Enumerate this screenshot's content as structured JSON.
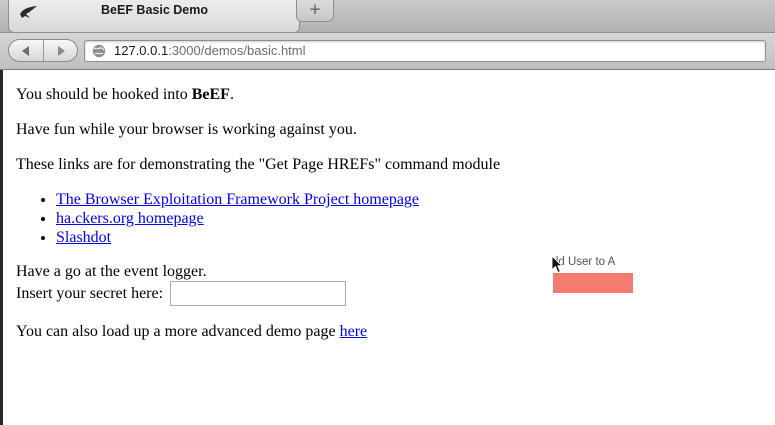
{
  "browser": {
    "tab_title": "BeEF Basic Demo",
    "new_tab_icon": "+",
    "url_host": "127.0.0.1",
    "url_rest": ":3000/demos/basic.html"
  },
  "page": {
    "hooked_prefix": "You should be hooked into ",
    "hooked_bold": "BeEF",
    "hooked_suffix": ".",
    "fun_text": "Have fun while your browser is working against you.",
    "links_intro": "These links are for demonstrating the \"Get Page HREFs\" command module",
    "links": [
      "The Browser Exploitation Framework Project homepage",
      "ha.ckers.org homepage",
      "Slashdot"
    ],
    "logger_text": "Have a go at the event logger.",
    "secret_label": "Insert your secret here:",
    "secret_value": "",
    "advanced_prefix": "You can also load up a more advanced demo page ",
    "advanced_link": "here"
  },
  "overlay": {
    "text": "dd User to A",
    "bar_color": "#f47b6f"
  }
}
